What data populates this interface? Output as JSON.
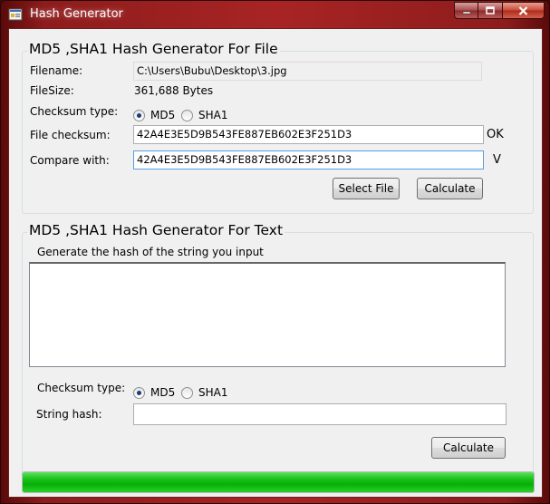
{
  "window": {
    "title": "Hash Generator"
  },
  "file_group": {
    "title": "MD5 ,SHA1 Hash Generator For File",
    "filename_label": "Filename:",
    "filename_value": "C:\\Users\\Bubu\\Desktop\\3.jpg",
    "filesize_label": "FileSize:",
    "filesize_value": "361,688 Bytes",
    "checksum_type_label": "Checksum type:",
    "radio_md5": "MD5",
    "radio_sha1": "SHA1",
    "selected_type": "MD5",
    "file_checksum_label": "File checksum:",
    "file_checksum_value": "42A4E3E5D9B543FE887EB602E3F251D3",
    "file_checksum_status": "OK",
    "compare_label": "Compare with:",
    "compare_value": "42A4E3E5D9B543FE887EB602E3F251D3",
    "compare_status": "V",
    "select_file_button": "Select File",
    "calculate_button": "Calculate"
  },
  "text_group": {
    "title": "MD5 ,SHA1 Hash Generator For Text",
    "instruction": "Generate the hash of the string you input",
    "input_text": "",
    "checksum_type_label": "Checksum type:",
    "radio_md5": "MD5",
    "radio_sha1": "SHA1",
    "selected_type": "MD5",
    "string_hash_label": "String hash:",
    "string_hash_value": "",
    "calculate_button": "Calculate"
  },
  "progress": {
    "value_percent": 100,
    "color": "#06b006"
  }
}
